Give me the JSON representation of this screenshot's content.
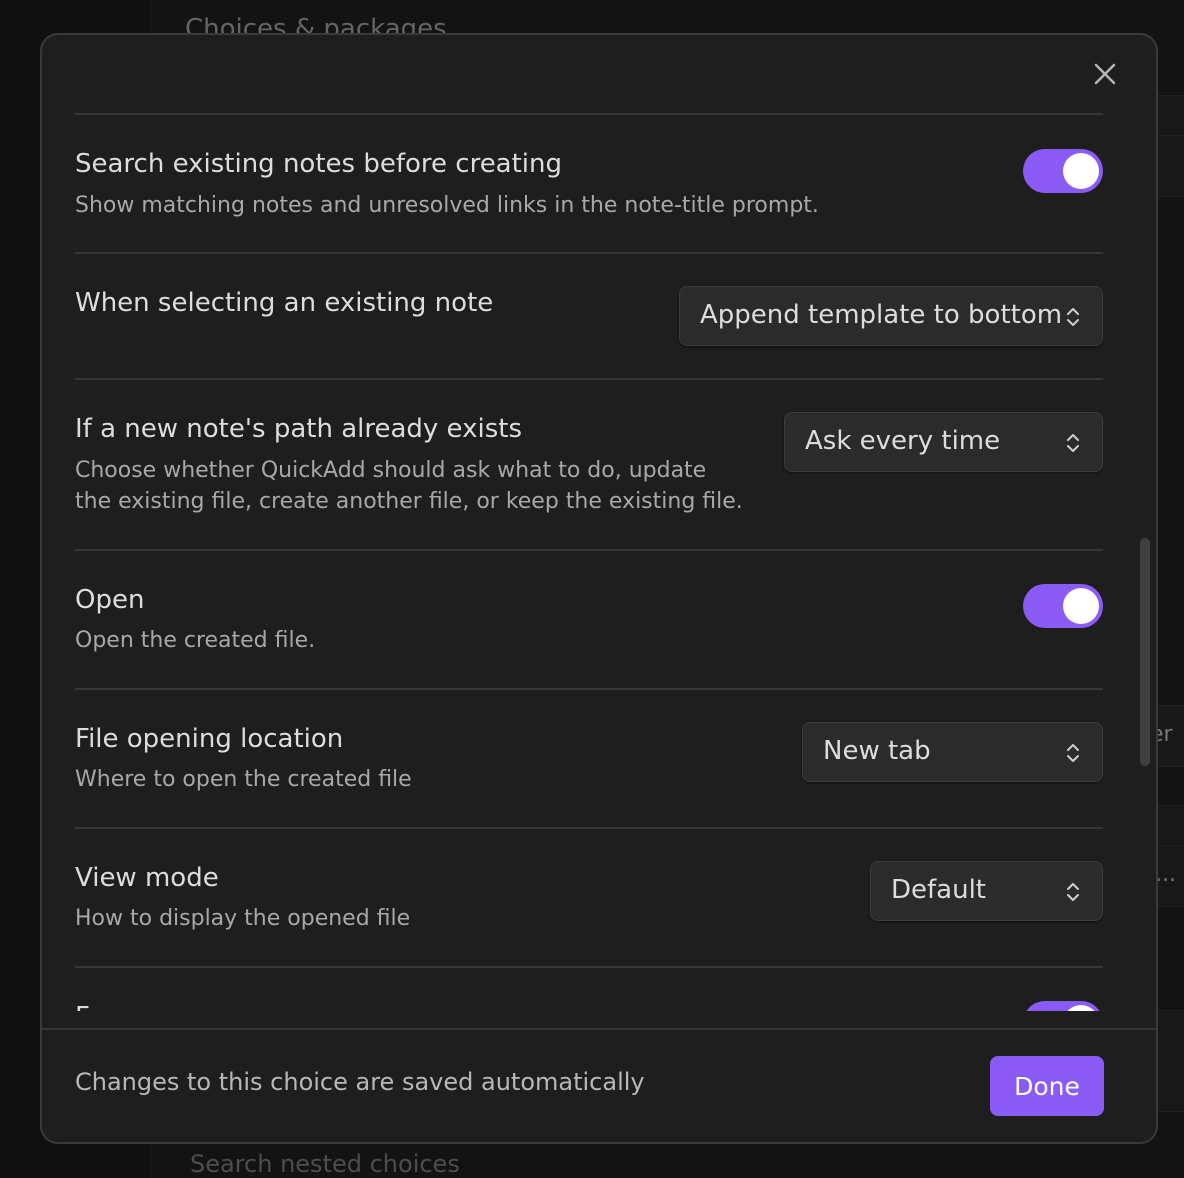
{
  "background": {
    "title": "Choices & packages",
    "search_placeholder": "Search nested choices",
    "partial_text_1": "er",
    "partial_text_2": "..."
  },
  "modal": {
    "close_icon": "close-icon",
    "settings": [
      {
        "name": "Search existing notes before creating",
        "desc": "Show matching notes and unresolved links in the note-title prompt.",
        "control": "toggle",
        "value": true
      },
      {
        "name": "When selecting an existing note",
        "desc": "",
        "control": "dropdown",
        "value": "Append template to bottom"
      },
      {
        "name": "If a new note's path already exists",
        "desc_line1": "Choose whether QuickAdd should ask what to do, update",
        "desc_line2": "the existing file, create another file, or keep the existing file.",
        "control": "dropdown",
        "value": "Ask every time"
      },
      {
        "name": "Open",
        "desc": "Open the created file.",
        "control": "toggle",
        "value": true
      },
      {
        "name": "File opening location",
        "desc": "Where to open the created file",
        "control": "dropdown",
        "value": "New tab"
      },
      {
        "name": "View mode",
        "desc": "How to display the opened file",
        "control": "dropdown",
        "value": "Default"
      },
      {
        "name": "F",
        "control": "toggle",
        "value": true
      }
    ],
    "footer": {
      "text": "Changes to this choice are saved automatically",
      "done_label": "Done"
    }
  },
  "colors": {
    "accent": "#8a5cf5",
    "modal_bg": "#1e1e1e",
    "divider": "#363636"
  }
}
